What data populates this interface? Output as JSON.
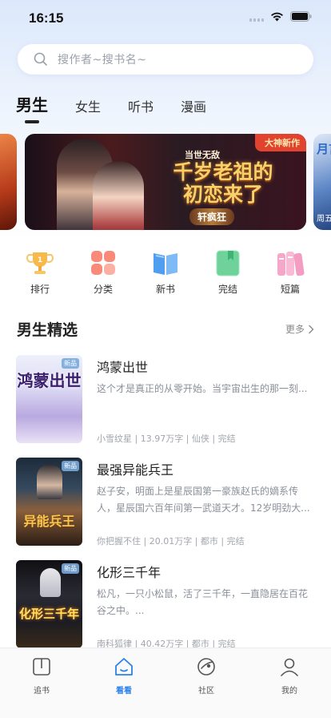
{
  "status_bar": {
    "time": "16:15"
  },
  "search": {
    "placeholder": "搜作者~搜书名~"
  },
  "top_tabs": [
    {
      "label": "男生",
      "active": true
    },
    {
      "label": "女生",
      "active": false
    },
    {
      "label": "听书",
      "active": false
    },
    {
      "label": "漫画",
      "active": false
    }
  ],
  "banner": {
    "tag": "大神新作",
    "small_title": "当世无敌",
    "title_line1": "千岁老祖的",
    "title_line2": "初恋来了",
    "author": "轩疯狂",
    "next_banner_text": "月言",
    "next_banner_sub": "周五"
  },
  "categories": [
    {
      "label": "排行",
      "icon": "trophy-icon"
    },
    {
      "label": "分类",
      "icon": "grid-icon"
    },
    {
      "label": "新书",
      "icon": "open-book-icon"
    },
    {
      "label": "完结",
      "icon": "bookmark-book-icon"
    },
    {
      "label": "短篇",
      "icon": "books-icon"
    }
  ],
  "section": {
    "title": "男生精选",
    "more_label": "更多"
  },
  "books": [
    {
      "title": "鸿蒙出世",
      "desc": "这个才是真正的从零开始。当宇宙出生的那一刻...",
      "meta": "小雪纹星 | 13.97万字 | 仙侠 | 完结",
      "cover_text": "鸿蒙出世",
      "cover_tag": "新品"
    },
    {
      "title": "最强异能兵王",
      "desc": "赵子安，明面上是星辰国第一豪族赵氏的嫡系传人，星辰国六百年间第一武道天才。12岁明劲大...",
      "meta": "你把握不住 | 20.01万字 | 都市 | 完结",
      "cover_text": "异能兵王",
      "cover_tag": "新品"
    },
    {
      "title": "化形三千年",
      "desc": "松凡，一只小松鼠，活了三千年，一直隐居在百花谷之中。...",
      "meta": "南科狐律 | 40.42万字 | 都市 | 完结",
      "cover_text": "化形三千年",
      "cover_tag": "新品"
    }
  ],
  "tabbar": [
    {
      "label": "追书",
      "icon": "book-icon",
      "active": false
    },
    {
      "label": "看看",
      "icon": "home-icon",
      "active": true
    },
    {
      "label": "社区",
      "icon": "community-icon",
      "active": false
    },
    {
      "label": "我的",
      "icon": "profile-icon",
      "active": false
    }
  ],
  "colors": {
    "accent": "#2b82e8",
    "background": "#ffffff"
  }
}
